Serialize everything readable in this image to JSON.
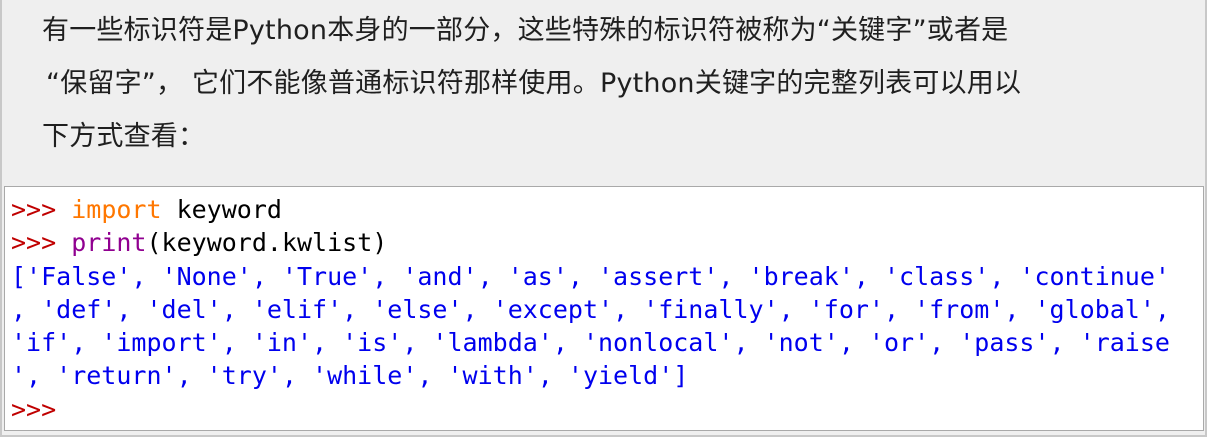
{
  "intro": {
    "line1": "有一些标识符是Python本身的一部分，这些特殊的标识符被称为“关键字”或者是",
    "line2": "“保留字”， 它们不能像普通标识符那样使用。Python关键字的完整列表可以用以",
    "line3": "下方式查看："
  },
  "shell": {
    "prompt": ">>>",
    "line1": {
      "keyword": "import",
      "rest": " keyword"
    },
    "line2": {
      "builtin": "print",
      "rest": "(keyword.kwlist)"
    },
    "output": [
      "['False', 'None', 'True', 'and', 'as', 'assert', 'break', 'class', 'continue'",
      ", 'def', 'del', 'elif', 'else', 'except', 'finally', 'for', 'from', 'global',",
      "'if', 'import', 'in', 'is', 'lambda', 'nonlocal', 'not', 'or', 'pass', 'raise",
      "', 'return', 'try', 'while', 'with', 'yield']"
    ]
  },
  "colors": {
    "prompt": "#c00000",
    "keyword": "#ff7700",
    "builtin": "#900090",
    "output": "#0000ee",
    "background": "#efefef",
    "shell_background": "#ffffff"
  }
}
